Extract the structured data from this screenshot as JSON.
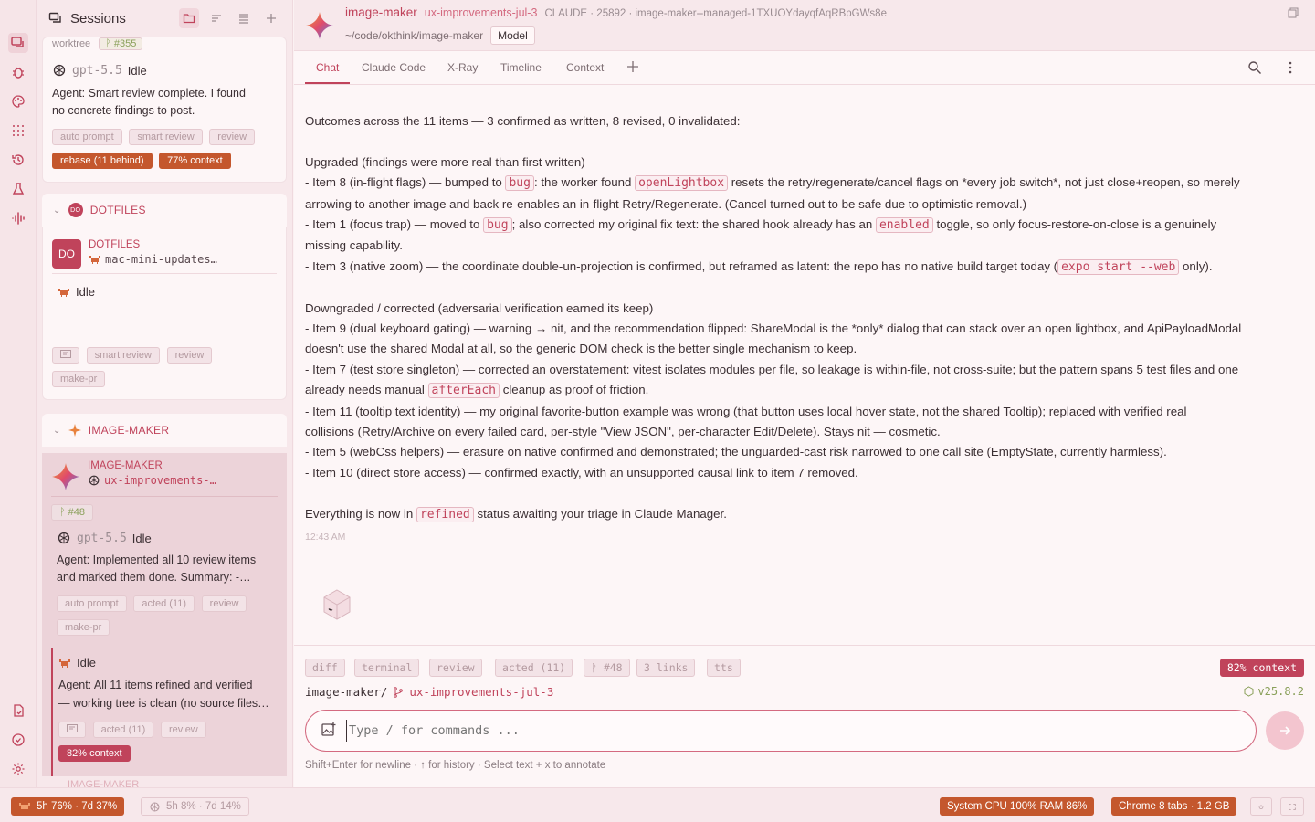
{
  "sessions": {
    "title": "Sessions",
    "card1": {
      "tag_worktree": "worktree",
      "tag_pr": "ᚹ #355",
      "model": "gpt-5.5",
      "state": "Idle",
      "summary1": "Agent: Smart review complete. I found",
      "summary2": "no concrete findings to post.",
      "chips": [
        "auto prompt",
        "smart review",
        "review"
      ],
      "chip_rebase": "rebase (11 behind)",
      "chip_context": "77% context"
    },
    "group_dotfiles": {
      "badge": "DO",
      "label": "DOTFILES"
    },
    "dotfiles_card": {
      "avatar": "DO",
      "name": "DOTFILES",
      "branch": "mac-mini-updates…",
      "state": "Idle",
      "chips": [
        "smart review",
        "review"
      ],
      "chip_makepr": "make-pr"
    },
    "group_imagemaker": {
      "label": "IMAGE-MAKER"
    },
    "imagemaker_card": {
      "name": "IMAGE-MAKER",
      "branch": "ux-improvements-…",
      "pr": "ᚹ #48",
      "model": "gpt-5.5",
      "state": "Idle",
      "summary1": "Agent: Implemented all 10 review items",
      "summary2": "and marked them done. Summary: -…",
      "chips": [
        "auto prompt",
        "acted (11)",
        "review"
      ],
      "chip_makepr": "make-pr",
      "sub_state": "Idle",
      "sub_summary1": "Agent: All 11 items refined and verified",
      "sub_summary2": "— working tree is clean (no source files…",
      "sub_chips": [
        "acted (11)",
        "review"
      ],
      "sub_context": "82% context"
    },
    "next_group_peek": "IMAGE-MAKER"
  },
  "header": {
    "repo": "image-maker",
    "branch": "ux-improvements-jul-3",
    "meta": "CLAUDE · 25892 · image-maker--managed-1TXUOYdayqfAqRBpGWs8e",
    "path": "~/code/okthink/image-maker",
    "model_button": "Model"
  },
  "tabs": [
    "Chat",
    "Claude Code",
    "X-Ray",
    "Timeline",
    "Context"
  ],
  "message": {
    "intro": "Outcomes across the 11 items — 3 confirmed as written, 8 revised, 0 invalidated:",
    "upgraded_head": "Upgraded (findings were more real than first written)",
    "u1a": "- Item 8 (in-flight flags) — bumped to ",
    "u1code1": "bug",
    "u1b": ": the worker found ",
    "u1code2": "openLightbox",
    "u1c": " resets the retry/regenerate/cancel flags on *every job switch*, not just close+reopen, so merely",
    "u1d": "arrowing to another image and back re-enables an in-flight Retry/Regenerate. (Cancel turned out to be safe due to optimistic removal.)",
    "u2a": "- Item 1 (focus trap) — moved to ",
    "u2code1": "bug",
    "u2b": "; also corrected my original fix text: the shared hook already has an ",
    "u2code2": "enabled",
    "u2c": " toggle, so only focus-restore-on-close is a genuinely",
    "u2d": "missing capability.",
    "u3a": "- Item 3 (native zoom) — the coordinate double-un-projection is confirmed, but reframed as latent: the repo has no native build target today (",
    "u3code": "expo start --web",
    "u3b": " only).",
    "down_head": "Downgraded / corrected (adversarial verification earned its keep)",
    "d1a": "- Item 9 (dual keyboard gating) — warning → nit, and the recommendation flipped: ShareModal is the *only* dialog that can stack over an open lightbox, and ApiPayloadModal",
    "d1b": "doesn't use the shared Modal at all, so the generic DOM check is the better single mechanism to keep.",
    "d2a": "- Item 7 (test store singleton) — corrected an overstatement: vitest isolates modules per file, so leakage is within-file, not cross-suite; but the pattern spans 5 test files and one",
    "d2b": "already needs manual ",
    "d2code": "afterEach",
    "d2c": " cleanup as proof of friction.",
    "d3a": "- Item 11 (tooltip text identity) — my original favorite-button example was wrong (that button uses local hover state, not the shared Tooltip); replaced with verified real",
    "d3b": "collisions (Retry/Archive on every failed card, per-style \"View JSON\", per-character Edit/Delete). Stays nit — cosmetic.",
    "d4": "- Item 5 (webCss helpers) — erasure on native confirmed and demonstrated; the unguarded-cast risk narrowed to one call site (EmptyState, currently harmless).",
    "d5": "- Item 10 (direct store access) — confirmed exactly, with an unsupported causal link to item 7 removed.",
    "end_a": "Everything is now in ",
    "end_code": "refined",
    "end_b": " status awaiting your triage in Claude Manager.",
    "time": "12:43 AM"
  },
  "composer": {
    "chips": [
      "diff",
      "terminal",
      "review",
      "acted (11)",
      "ᚹ #48",
      "3 links",
      "tts"
    ],
    "context": "82% context",
    "path": "image-maker/",
    "branch": "ux-improvements-jul-3",
    "version": "v25.8.2",
    "placeholder": "Type / for commands ...",
    "hint": "Shift+Enter for newline · ↑ for history · Select text + x to annotate"
  },
  "statusbar": {
    "claude_usage": "5h 76% · 7d 37%",
    "gpt_usage": "5h 8% · 7d 14%",
    "system": "System CPU 100% RAM 86%",
    "chrome": "Chrome 8 tabs · 1.2 GB"
  }
}
